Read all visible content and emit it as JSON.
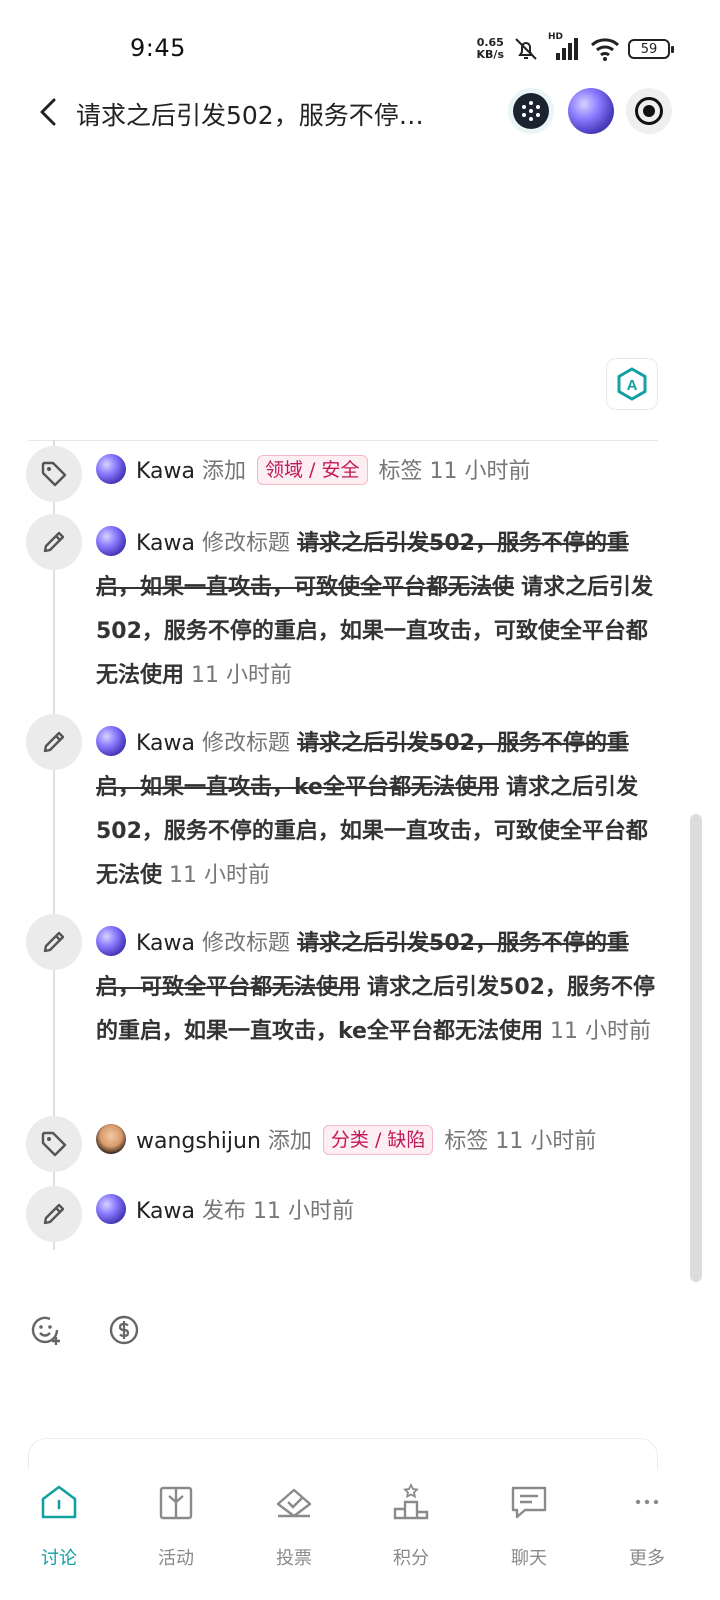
{
  "status_bar": {
    "time": "9:45",
    "net_speed_value": "0.65",
    "net_speed_unit": "KB/s",
    "network_label": "HD",
    "battery": "59"
  },
  "header": {
    "title": "请求之后引发502，服务不停…"
  },
  "translate_button": {
    "label": "A"
  },
  "timeline": [
    {
      "icon": "tag-icon",
      "user": "Kawa",
      "action": "添加",
      "tag": "领域 / 安全",
      "suffix": "标签",
      "time": "11 小时前"
    },
    {
      "icon": "pencil-icon",
      "user": "Kawa",
      "action": "修改标题",
      "old_title": "请求之后引发502，服务不停的重启，如果一直攻击，可致使全平台都无法使",
      "new_title": "请求之后引发502，服务不停的重启，如果一直攻击，可致使全平台都无法使用",
      "time": "11 小时前"
    },
    {
      "icon": "pencil-icon",
      "user": "Kawa",
      "action": "修改标题",
      "old_title": "请求之后引发502，服务不停的重启，如果一直攻击，ke全平台都无法使用",
      "new_title": "请求之后引发502，服务不停的重启，如果一直攻击，可致使全平台都无法使",
      "time": "11 小时前"
    },
    {
      "icon": "pencil-icon",
      "user": "Kawa",
      "action": "修改标题",
      "old_title": "请求之后引发502，服务不停的重启，可致全平台都无法使用",
      "new_title": "请求之后引发502，服务不停的重启，如果一直攻击，ke全平台都无法使用",
      "time": "11 小时前"
    },
    {
      "icon": "tag-icon",
      "user": "wangshijun",
      "action": "添加",
      "tag": "分类 / 缺陷",
      "suffix": "标签",
      "time": "11 小时前"
    },
    {
      "icon": "pencil-icon",
      "user": "Kawa",
      "action": "发布",
      "time": "11 小时前"
    }
  ],
  "bottom_nav": [
    {
      "label": "讨论",
      "icon": "home-icon",
      "active": true
    },
    {
      "label": "活动",
      "icon": "gift-icon",
      "active": false
    },
    {
      "label": "投票",
      "icon": "vote-icon",
      "active": false
    },
    {
      "label": "积分",
      "icon": "podium-icon",
      "active": false
    },
    {
      "label": "聊天",
      "icon": "chat-icon",
      "active": false
    },
    {
      "label": "更多",
      "icon": "more-icon",
      "active": false
    }
  ],
  "colors": {
    "accent": "#13a0a0",
    "tag_text": "#c2185b",
    "tag_bg": "#fdeef1"
  }
}
